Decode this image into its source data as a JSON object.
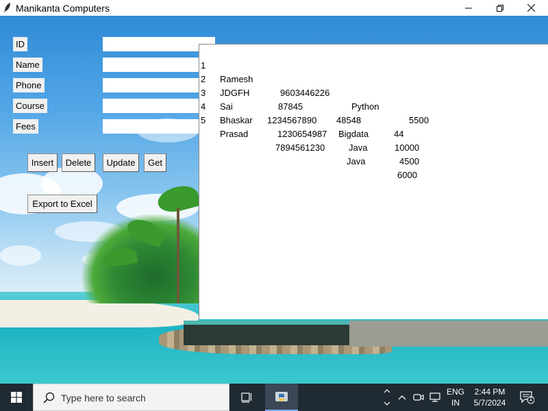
{
  "window": {
    "title": "Manikanta Computers",
    "minimize_icon": "minimize-icon",
    "maximize_icon": "restore-icon",
    "close_icon": "close-icon"
  },
  "form": {
    "fields": [
      {
        "label": "ID",
        "value": ""
      },
      {
        "label": "Name",
        "value": ""
      },
      {
        "label": "Phone",
        "value": ""
      },
      {
        "label": "Course",
        "value": ""
      },
      {
        "label": "Fees",
        "value": ""
      }
    ],
    "buttons": {
      "insert": "Insert",
      "delete": "Delete",
      "update": "Update",
      "get": "Get",
      "export": "Export to Excel"
    }
  },
  "listbox": {
    "rows": [
      {
        "num": "1",
        "name": "Ramesh",
        "phone": "9603446226",
        "course": "Python",
        "fees": "5500"
      },
      {
        "num": "2",
        "name": "JDGFH",
        "phone": "87845",
        "course": "48548",
        "fees": "44"
      },
      {
        "num": "3",
        "name": "Sai",
        "phone": "1234567890",
        "course": "Bigdata",
        "fees": "10000"
      },
      {
        "num": "4",
        "name": "Bhaskar",
        "phone": "1230654987",
        "course": "Java",
        "fees": "4500"
      },
      {
        "num": "5",
        "name": "Prasad",
        "phone": "7894561230",
        "course": "Java",
        "fees": "6000"
      }
    ]
  },
  "taskbar": {
    "search_placeholder": "Type here to search",
    "language_line1": "ENG",
    "language_line2": "IN",
    "time": "2:44 PM",
    "date": "5/7/2024",
    "notification_count": "1",
    "icons": [
      "windows-start-icon",
      "search-icon",
      "task-view-icon",
      "python-icon",
      "chevron-up-icon",
      "meet-now-icon",
      "network-icon",
      "notification-icon"
    ]
  },
  "colors": {
    "taskbar_bg": "#1f2a33",
    "label_bg": "#f0f0f0",
    "button_bg": "#f0f0f0"
  }
}
